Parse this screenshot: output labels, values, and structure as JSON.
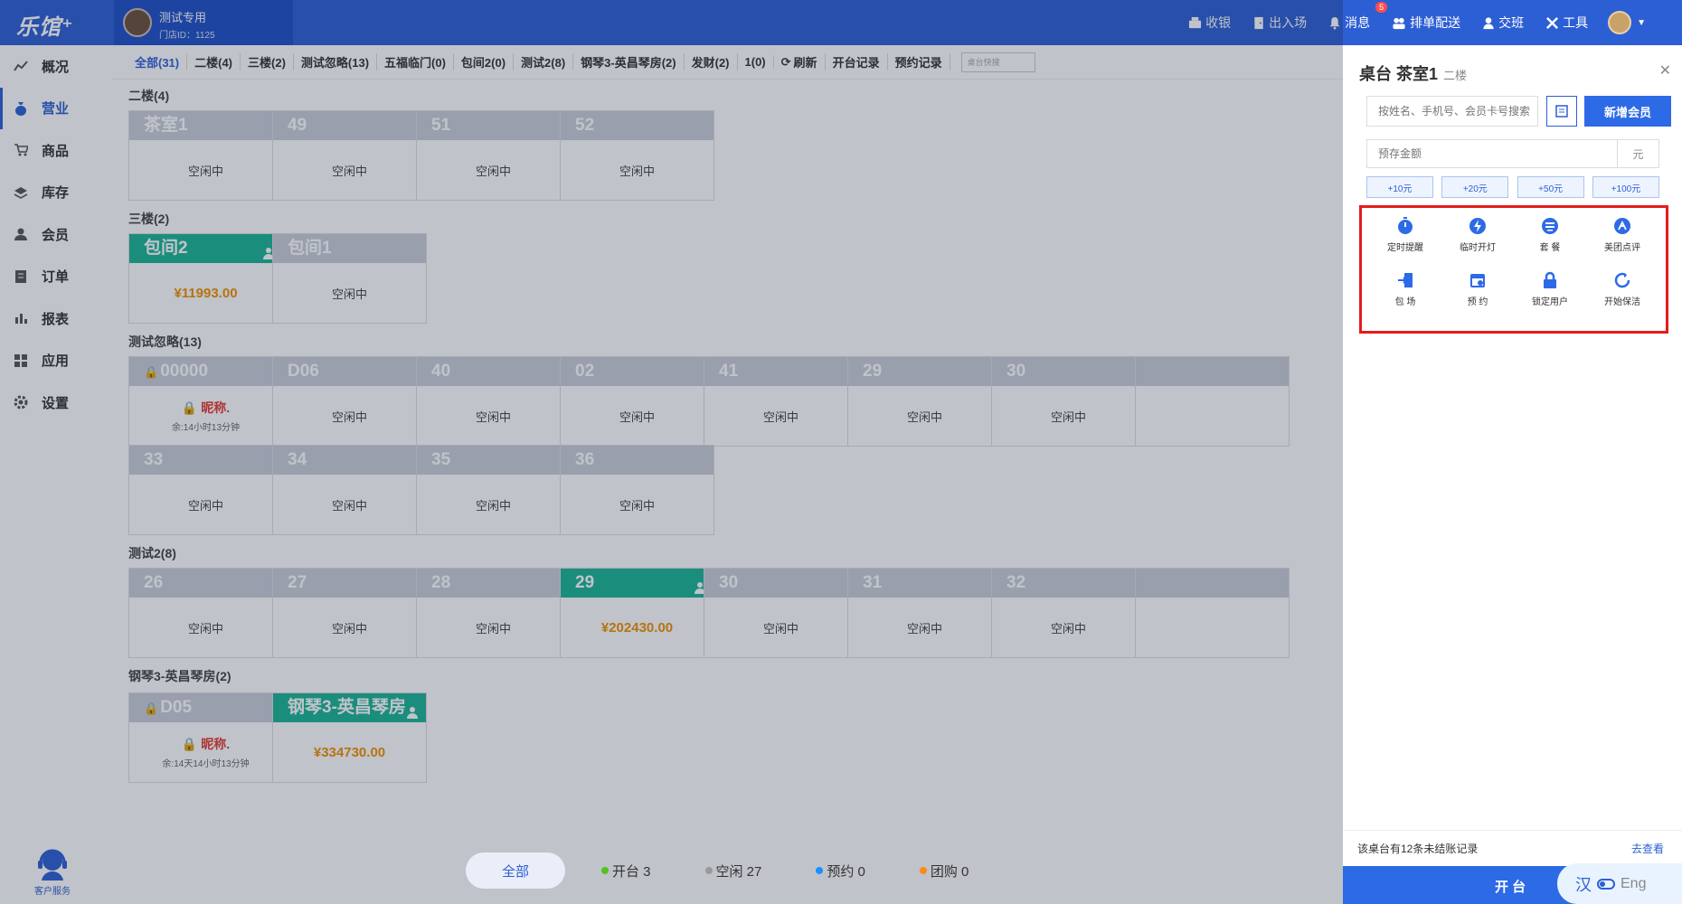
{
  "topbar": {
    "logo": "乐馆⁺",
    "store_name": "测试专用",
    "store_id": "门店ID：1125",
    "nav": [
      {
        "label": "收银",
        "icon": "cashier-icon"
      },
      {
        "label": "出入场",
        "icon": "door-icon"
      },
      {
        "label": "消息",
        "icon": "bell-icon",
        "badge": "5"
      },
      {
        "label": "排单配送",
        "icon": "users-icon"
      },
      {
        "label": "交班",
        "icon": "shift-icon"
      },
      {
        "label": "工具",
        "icon": "tools-icon"
      }
    ]
  },
  "sidebar": {
    "items": [
      {
        "label": "概况",
        "icon": "chart-icon"
      },
      {
        "label": "营业",
        "icon": "money-bag-icon",
        "active": true
      },
      {
        "label": "商品",
        "icon": "cart-icon"
      },
      {
        "label": "库存",
        "icon": "layers-icon"
      },
      {
        "label": "会员",
        "icon": "user-icon"
      },
      {
        "label": "订单",
        "icon": "order-icon"
      },
      {
        "label": "报表",
        "icon": "report-icon"
      },
      {
        "label": "应用",
        "icon": "apps-icon"
      },
      {
        "label": "设置",
        "icon": "gear-icon"
      }
    ],
    "service": "客户服务"
  },
  "tabs": {
    "items": [
      "全部(31)",
      "二楼(4)",
      "三楼(2)",
      "测试忽略(13)",
      "五福临门(0)",
      "包间2(0)",
      "测试2(8)",
      "钢琴3-英昌琴房(2)",
      "发财(2)",
      "1(0)"
    ],
    "refresh": "刷新",
    "open_record": "开台记录",
    "reserve_record": "预约记录",
    "search_placeholder": "桌台快搜"
  },
  "sections": [
    {
      "title": "二楼(4)",
      "tables": [
        {
          "name": "茶室1",
          "status": "空闲中"
        },
        {
          "name": "49",
          "status": "空闲中"
        },
        {
          "name": "51",
          "status": "空闲中"
        },
        {
          "name": "52",
          "status": "空闲中"
        }
      ]
    },
    {
      "title": "三楼(2)",
      "tables": [
        {
          "name": "包间2",
          "amount": "¥11993.00",
          "busy": true
        },
        {
          "name": "包间1",
          "status": "空闲中"
        }
      ]
    },
    {
      "title": "测试忽略(13)",
      "tables": [
        {
          "name": "00000",
          "nick": "昵称.",
          "remain": "余:14小时13分钟",
          "locked": true
        },
        {
          "name": "D06",
          "status": "空闲中"
        },
        {
          "name": "40",
          "status": "空闲中"
        },
        {
          "name": "02",
          "status": "空闲中"
        },
        {
          "name": "41",
          "status": "空闲中"
        },
        {
          "name": "29",
          "status": "空闲中"
        },
        {
          "name": "30",
          "status": "空闲中"
        },
        {
          "name": "33",
          "status": "空闲中"
        },
        {
          "name": "34",
          "status": "空闲中"
        },
        {
          "name": "35",
          "status": "空闲中"
        },
        {
          "name": "36",
          "status": "空闲中"
        }
      ]
    },
    {
      "title": "测试2(8)",
      "tables": [
        {
          "name": "26",
          "status": "空闲中"
        },
        {
          "name": "27",
          "status": "空闲中"
        },
        {
          "name": "28",
          "status": "空闲中"
        },
        {
          "name": "29",
          "amount": "¥202430.00",
          "busy": true
        },
        {
          "name": "30",
          "status": "空闲中"
        },
        {
          "name": "31",
          "status": "空闲中"
        },
        {
          "name": "32",
          "status": "空闲中"
        }
      ]
    },
    {
      "title": "钢琴3-英昌琴房(2)",
      "tables": [
        {
          "name": "D05",
          "nick": "昵称.",
          "remain": "余:14天14小时13分钟",
          "locked": true
        },
        {
          "name": "钢琴3-英昌琴房",
          "amount": "¥334730.00",
          "busy": true
        }
      ]
    }
  ],
  "stats": {
    "all": "全部",
    "open": "开台 3",
    "idle": "空闲 27",
    "reserve": "预约 0",
    "group": "团购 0",
    "colors": {
      "open": "#52c41a",
      "idle": "#999999",
      "reserve": "#1890ff",
      "group": "#fa8c16"
    }
  },
  "panel": {
    "title": "桌台 茶室1",
    "subtitle": "二楼",
    "search_placeholder": "按姓名、手机号、会员卡号搜索",
    "new_member": "新增会员",
    "amount_placeholder": "预存金额",
    "unit": "元",
    "quick": [
      "+10元",
      "+20元",
      "+50元",
      "+100元"
    ],
    "functions": [
      {
        "label": "定时提醒",
        "icon": "timer-icon"
      },
      {
        "label": "临时开灯",
        "icon": "lightning-icon"
      },
      {
        "label": "套 餐",
        "icon": "package-icon"
      },
      {
        "label": "美团点评",
        "icon": "meituan-icon"
      },
      {
        "label": "包 场",
        "icon": "enter-icon"
      },
      {
        "label": "预 约",
        "icon": "calendar-icon"
      },
      {
        "label": "锁定用户",
        "icon": "lock-icon"
      },
      {
        "label": "开始保洁",
        "icon": "refresh-circle-icon"
      }
    ],
    "notice": "该桌台有12条未结账记录",
    "notice_link": "去查看",
    "open_button": "开 台"
  },
  "ime": {
    "zh": "汉",
    "en": "Eng"
  }
}
